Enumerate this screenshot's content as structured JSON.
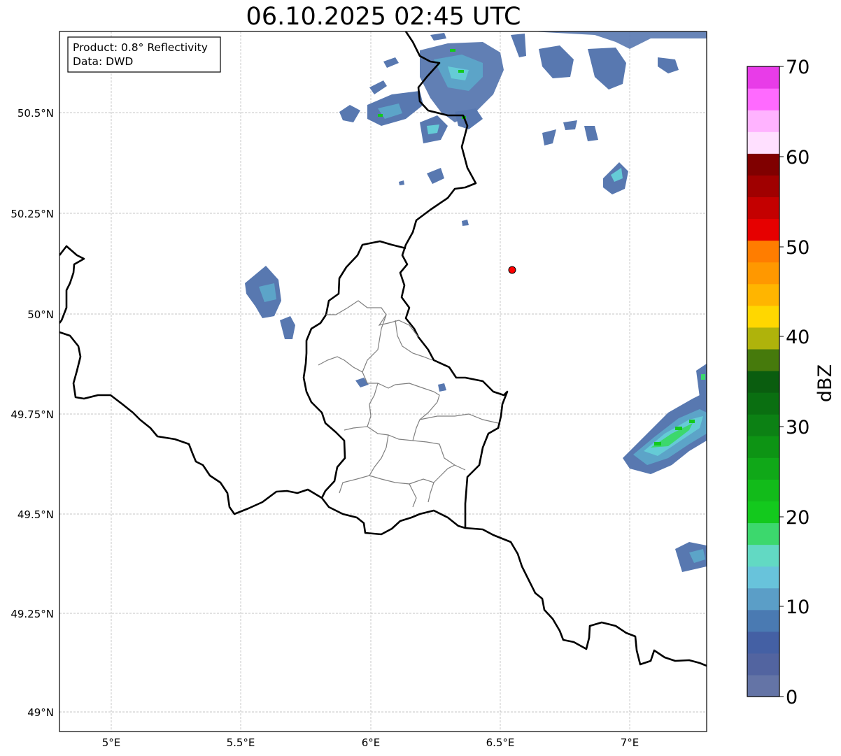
{
  "map": {
    "title": "06.10.2025 02:45 UTC",
    "info_box": {
      "product": "Product: 0.8° Reflectivity",
      "data": "Data: DWD"
    },
    "lon_ticks": [
      "5°E",
      "5.5°E",
      "6°E",
      "6.5°E",
      "7°E"
    ],
    "lat_ticks": [
      "50.5°N",
      "50.25°N",
      "50°N",
      "49.75°N",
      "49.5°N",
      "49.25°N",
      "49°N"
    ],
    "grid": true,
    "marker": {
      "lon": 6.55,
      "lat": 50.11,
      "color": "#ff0000"
    }
  },
  "colorbar": {
    "label": "dBZ",
    "tick_labels": [
      "0",
      "10",
      "20",
      "30",
      "40",
      "50",
      "60",
      "70"
    ],
    "range": [
      0,
      70
    ],
    "colors": [
      "#6474a6",
      "#5264a0",
      "#4460a4",
      "#4a7ab2",
      "#5b9ec7",
      "#68c3db",
      "#62d9c3",
      "#3cd86d",
      "#13c91d",
      "#12bb1a",
      "#10a818",
      "#0d9414",
      "#0c8114",
      "#0a6f11",
      "#0a5d0f",
      "#467a0c",
      "#afb30b",
      "#ffd700",
      "#ffb500",
      "#ff9800",
      "#ff7d00",
      "#e60000",
      "#c40000",
      "#a00000",
      "#800000",
      "#ffe0ff",
      "#ffb3ff",
      "#ff6aff",
      "#e83ce8"
    ]
  }
}
